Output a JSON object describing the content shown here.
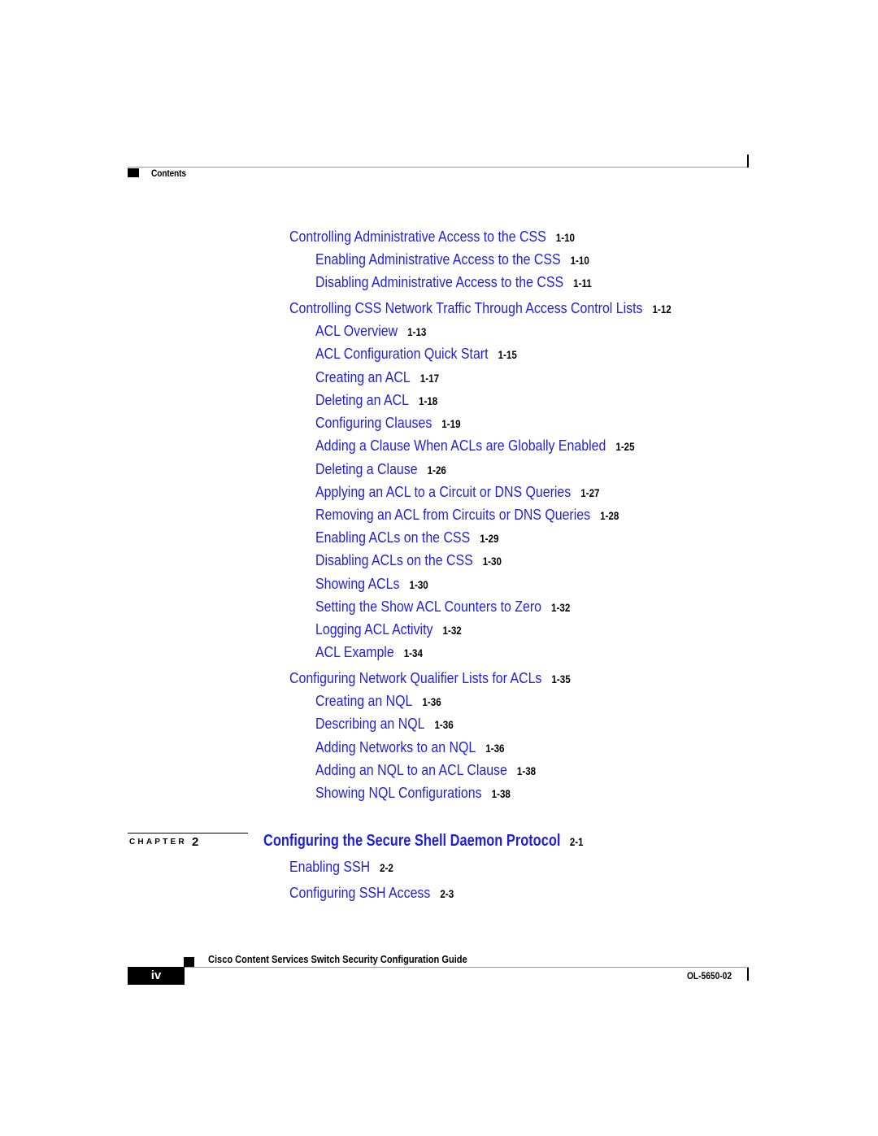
{
  "header": {
    "section_label": "Contents"
  },
  "toc": [
    {
      "level": 1,
      "title": "Controlling Administrative Access to the CSS",
      "page": "1-10"
    },
    {
      "level": 2,
      "title": "Enabling Administrative Access to the CSS",
      "page": "1-10"
    },
    {
      "level": 2,
      "title": "Disabling Administrative Access to the CSS",
      "page": "1-11"
    },
    {
      "level": 1,
      "title": "Controlling CSS Network Traffic Through Access Control Lists",
      "page": "1-12"
    },
    {
      "level": 2,
      "title": "ACL Overview",
      "page": "1-13"
    },
    {
      "level": 2,
      "title": "ACL Configuration Quick Start",
      "page": "1-15"
    },
    {
      "level": 2,
      "title": "Creating an ACL",
      "page": "1-17"
    },
    {
      "level": 2,
      "title": "Deleting an ACL",
      "page": "1-18"
    },
    {
      "level": 2,
      "title": "Configuring Clauses",
      "page": "1-19"
    },
    {
      "level": 2,
      "title": "Adding a Clause When ACLs are Globally Enabled",
      "page": "1-25"
    },
    {
      "level": 2,
      "title": "Deleting a Clause",
      "page": "1-26"
    },
    {
      "level": 2,
      "title": "Applying an ACL to a Circuit or DNS Queries",
      "page": "1-27"
    },
    {
      "level": 2,
      "title": "Removing an ACL from Circuits or DNS Queries",
      "page": "1-28"
    },
    {
      "level": 2,
      "title": "Enabling ACLs on the CSS",
      "page": "1-29"
    },
    {
      "level": 2,
      "title": "Disabling ACLs on the CSS",
      "page": "1-30"
    },
    {
      "level": 2,
      "title": "Showing ACLs",
      "page": "1-30"
    },
    {
      "level": 2,
      "title": "Setting the Show ACL Counters to Zero",
      "page": "1-32"
    },
    {
      "level": 2,
      "title": "Logging ACL Activity",
      "page": "1-32"
    },
    {
      "level": 2,
      "title": "ACL Example",
      "page": "1-34"
    },
    {
      "level": 1,
      "title": "Configuring Network Qualifier Lists for ACLs",
      "page": "1-35"
    },
    {
      "level": 2,
      "title": "Creating an NQL",
      "page": "1-36"
    },
    {
      "level": 2,
      "title": "Describing an NQL",
      "page": "1-36"
    },
    {
      "level": 2,
      "title": "Adding Networks to an NQL",
      "page": "1-36"
    },
    {
      "level": 2,
      "title": "Adding an NQL to an ACL Clause",
      "page": "1-38"
    },
    {
      "level": 2,
      "title": "Showing NQL Configurations",
      "page": "1-38"
    }
  ],
  "chapter": {
    "label": "CHAPTER",
    "number": "2",
    "title": "Configuring the Secure Shell Daemon Protocol",
    "page": "2-1",
    "entries": [
      {
        "level": 1,
        "title": "Enabling SSH",
        "page": "2-2"
      },
      {
        "level": 1,
        "title": "Configuring SSH Access",
        "page": "2-3"
      }
    ]
  },
  "footer": {
    "page_number": "iv",
    "guide_title": "Cisco Content Services Switch Security Configuration Guide",
    "doc_number": "OL-5650-02"
  }
}
